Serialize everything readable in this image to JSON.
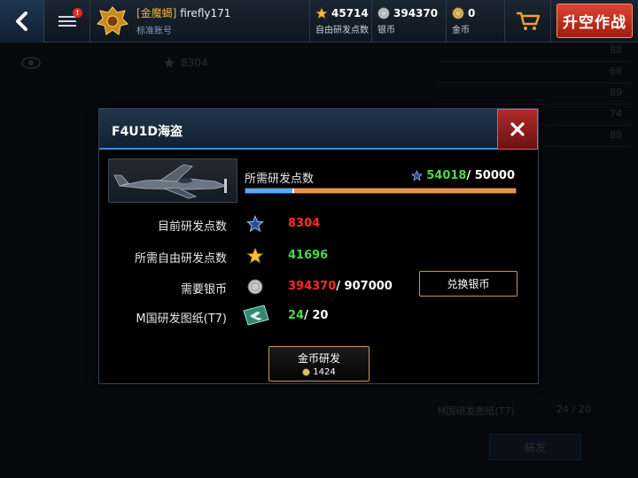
{
  "topbar": {
    "guild": "[金魔蝎]",
    "nickname": "firefly171",
    "account_type": "标准账号",
    "free_points": "45714",
    "free_points_label": "自由研发点数",
    "silver": "394370",
    "silver_label": "银币",
    "gold": "0",
    "gold_label": "金币",
    "battle_button": "升空作战",
    "menu_badge": "!"
  },
  "background": {
    "research_value": "8304",
    "stats": [
      "88",
      "68",
      "89",
      "74",
      "88"
    ],
    "blueprint_label": "M国研发图纸(T7)",
    "blueprint_count": "24 / 20",
    "research_button": "研发"
  },
  "dialog": {
    "title": "F4U1D海盗",
    "required_label": "所需研发点数",
    "required_current": "54018",
    "required_total": "/ 50000",
    "progress_fraction": 0.18,
    "rows": [
      {
        "label": "目前研发点数",
        "value": "8304",
        "total": ""
      },
      {
        "label": "所需自由研发点数",
        "value": "41696",
        "total": ""
      },
      {
        "label": "需要银币",
        "value": "394370",
        "total": "/ 907000"
      },
      {
        "label": "M国研发图纸(T7)",
        "value": "24",
        "total": "/ 20"
      }
    ],
    "exchange_button": "兑换银币",
    "gold_research_button": "金币研发",
    "gold_cost": "1424"
  },
  "colors": {
    "accent_blue": "#3d8fd8",
    "battle_red": "#c0281a",
    "value_red": "#ff2a2a",
    "value_green": "#4ad84a",
    "progress_orange": "#e8934a",
    "progress_blue": "#55aaff"
  }
}
